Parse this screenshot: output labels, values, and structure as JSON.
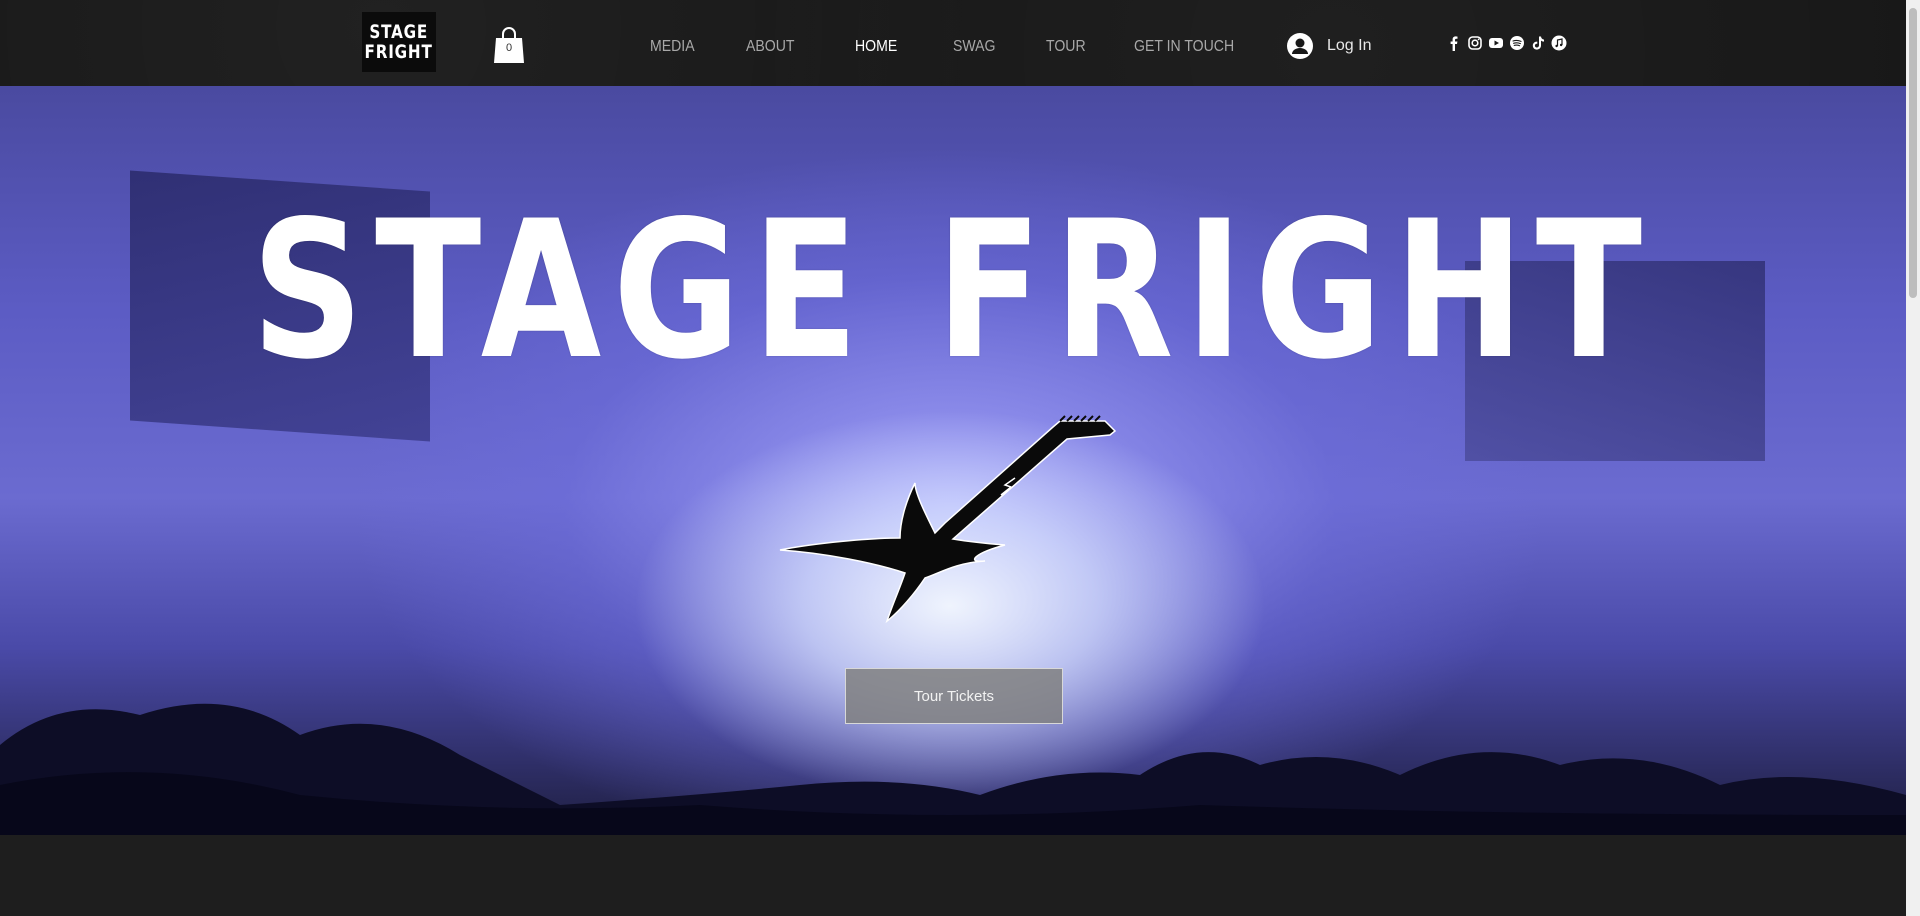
{
  "header": {
    "logo_text": [
      "STAGE",
      "FRIGHT"
    ],
    "cart": {
      "count": "0",
      "icon": "shopping-bag-icon"
    },
    "nav": [
      {
        "label": "MEDIA",
        "active": false
      },
      {
        "label": "ABOUT",
        "active": false
      },
      {
        "label": "HOME",
        "active": true
      },
      {
        "label": "SWAG",
        "active": false
      },
      {
        "label": "TOUR",
        "active": false
      },
      {
        "label": "GET IN TOUCH",
        "active": false
      }
    ],
    "login": {
      "label": "Log In",
      "icon": "user-avatar-icon"
    },
    "social": [
      "facebook-icon",
      "instagram-icon",
      "youtube-icon",
      "spotify-icon",
      "tiktok-icon",
      "apple-music-icon"
    ]
  },
  "hero": {
    "title": "STAGE FRIGHT",
    "cta_label": "Tour Tickets",
    "guitar_icon": "electric-guitar-icon"
  },
  "colors": {
    "header_bg": "#181818",
    "nav_text": "#a8a8a8",
    "nav_active": "#ffffff",
    "button_bg": "#808080"
  }
}
